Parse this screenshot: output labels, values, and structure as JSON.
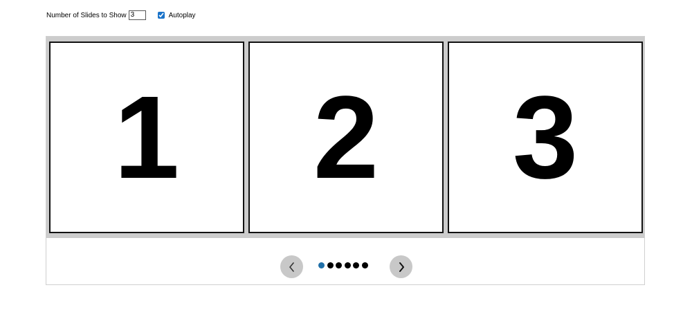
{
  "controls": {
    "slides_label": "Number of Slides to Show",
    "slides_value": "3",
    "autoplay_label": "Autoplay",
    "autoplay_checked": true
  },
  "slides": [
    {
      "label": "1"
    },
    {
      "label": "2"
    },
    {
      "label": "3"
    }
  ],
  "nav": {
    "prev_icon": "chevron-left-icon",
    "next_icon": "chevron-right-icon",
    "dot_count": 6,
    "active_dot": 0
  },
  "colors": {
    "track_background": "#cccccc",
    "arrow_background": "#c8c8c8",
    "active_dot": "#1f6fa8",
    "dot": "#000000"
  }
}
